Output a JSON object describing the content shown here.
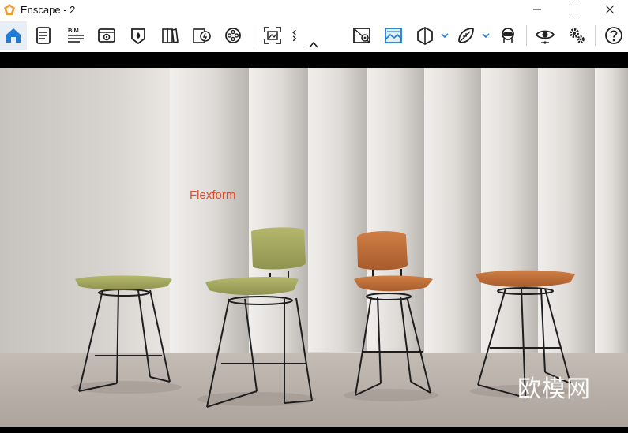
{
  "window": {
    "title": "Enscape - 2",
    "bim_label": "BIM"
  },
  "toolbar": {
    "left_icons": [
      "home-icon",
      "document-icon",
      "bim-icon",
      "web-standalone-icon",
      "panorama-icon",
      "book-icon",
      "batch-render-icon",
      "video-reel-icon"
    ],
    "right_icons": [
      "map-pin-icon",
      "image-landscape-icon",
      "cube-icon",
      "leaf-icon",
      "vr-headset-icon",
      "eye-icon",
      "settings-icon",
      "help-icon"
    ]
  },
  "viewport": {
    "brand_text": "Flexform",
    "watermark_text": "欧模网"
  },
  "colors": {
    "accent": "#1f7bd6",
    "brand_red": "#e24a2a",
    "stool_green": "#a8ac62",
    "stool_orange": "#c0703a"
  }
}
